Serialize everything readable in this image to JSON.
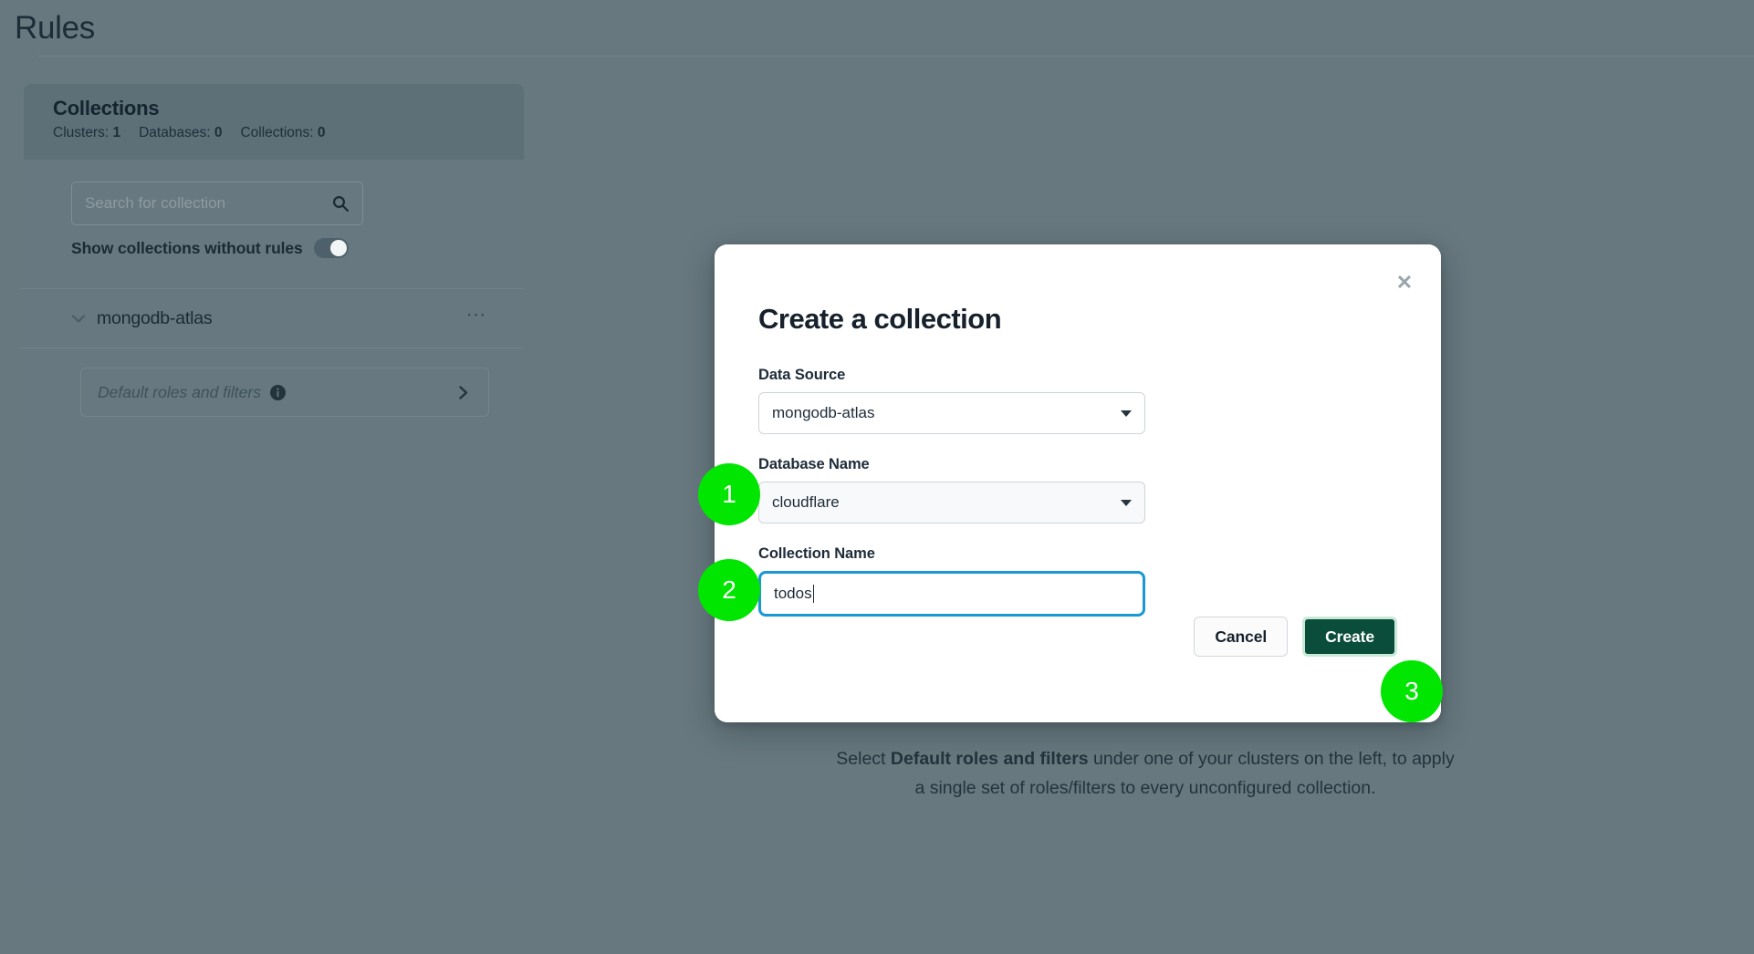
{
  "page": {
    "title": "Rules"
  },
  "sidebar": {
    "heading": "Collections",
    "counts": [
      {
        "label": "Clusters:",
        "value": "1"
      },
      {
        "label": "Databases:",
        "value": "0"
      },
      {
        "label": "Collections:",
        "value": "0"
      }
    ],
    "search": {
      "placeholder": "Search for collection",
      "value": "",
      "icon": "search-icon"
    },
    "toggle": {
      "label": "Show collections without rules",
      "state": "on"
    },
    "tree": [
      {
        "label": "mongodb-atlas",
        "expanded": true,
        "chevron_icon": "chevron-down-icon",
        "menu_icon": "ellipsis-icon",
        "children": [
          {
            "label": "Default roles and filters",
            "info_icon": "info-icon",
            "chevron_icon": "chevron-right-icon"
          }
        ]
      }
    ]
  },
  "content": {
    "empty_state": {
      "prefix": "Select ",
      "bold": "Default roles and filters",
      "middle": " under one of your clusters on the left, to apply",
      "line2": "a single set of roles/filters to every unconfigured collection."
    }
  },
  "modal": {
    "title": "Create a collection",
    "close_icon": "close-icon",
    "fields": [
      {
        "label": "Data Source",
        "type": "select",
        "value": "mongodb-atlas",
        "caret_icon": "chevron-down-icon"
      },
      {
        "label": "Database Name",
        "type": "select",
        "value": "cloudflare",
        "caret_icon": "chevron-down-icon"
      },
      {
        "label": "Collection Name",
        "type": "text",
        "value": "todos",
        "placeholder": ""
      }
    ],
    "actions": {
      "cancel_label": "Cancel",
      "create_label": "Create"
    }
  },
  "annotations": {
    "badges": [
      {
        "number": "1",
        "target": "database-name-field"
      },
      {
        "number": "2",
        "target": "collection-name-field"
      },
      {
        "number": "3",
        "target": "create-button"
      }
    ],
    "badge_color": "#00e600"
  },
  "colors": {
    "page_background": "#68787f",
    "panel_header": "#5d6f77",
    "panel_body": "#677880",
    "text_dark": "#1b2b35",
    "modal_background": "#ffffff",
    "input_focus_border": "#1899d6",
    "create_button": "#0b4d3b",
    "create_button_halo": "#c8ead9"
  }
}
